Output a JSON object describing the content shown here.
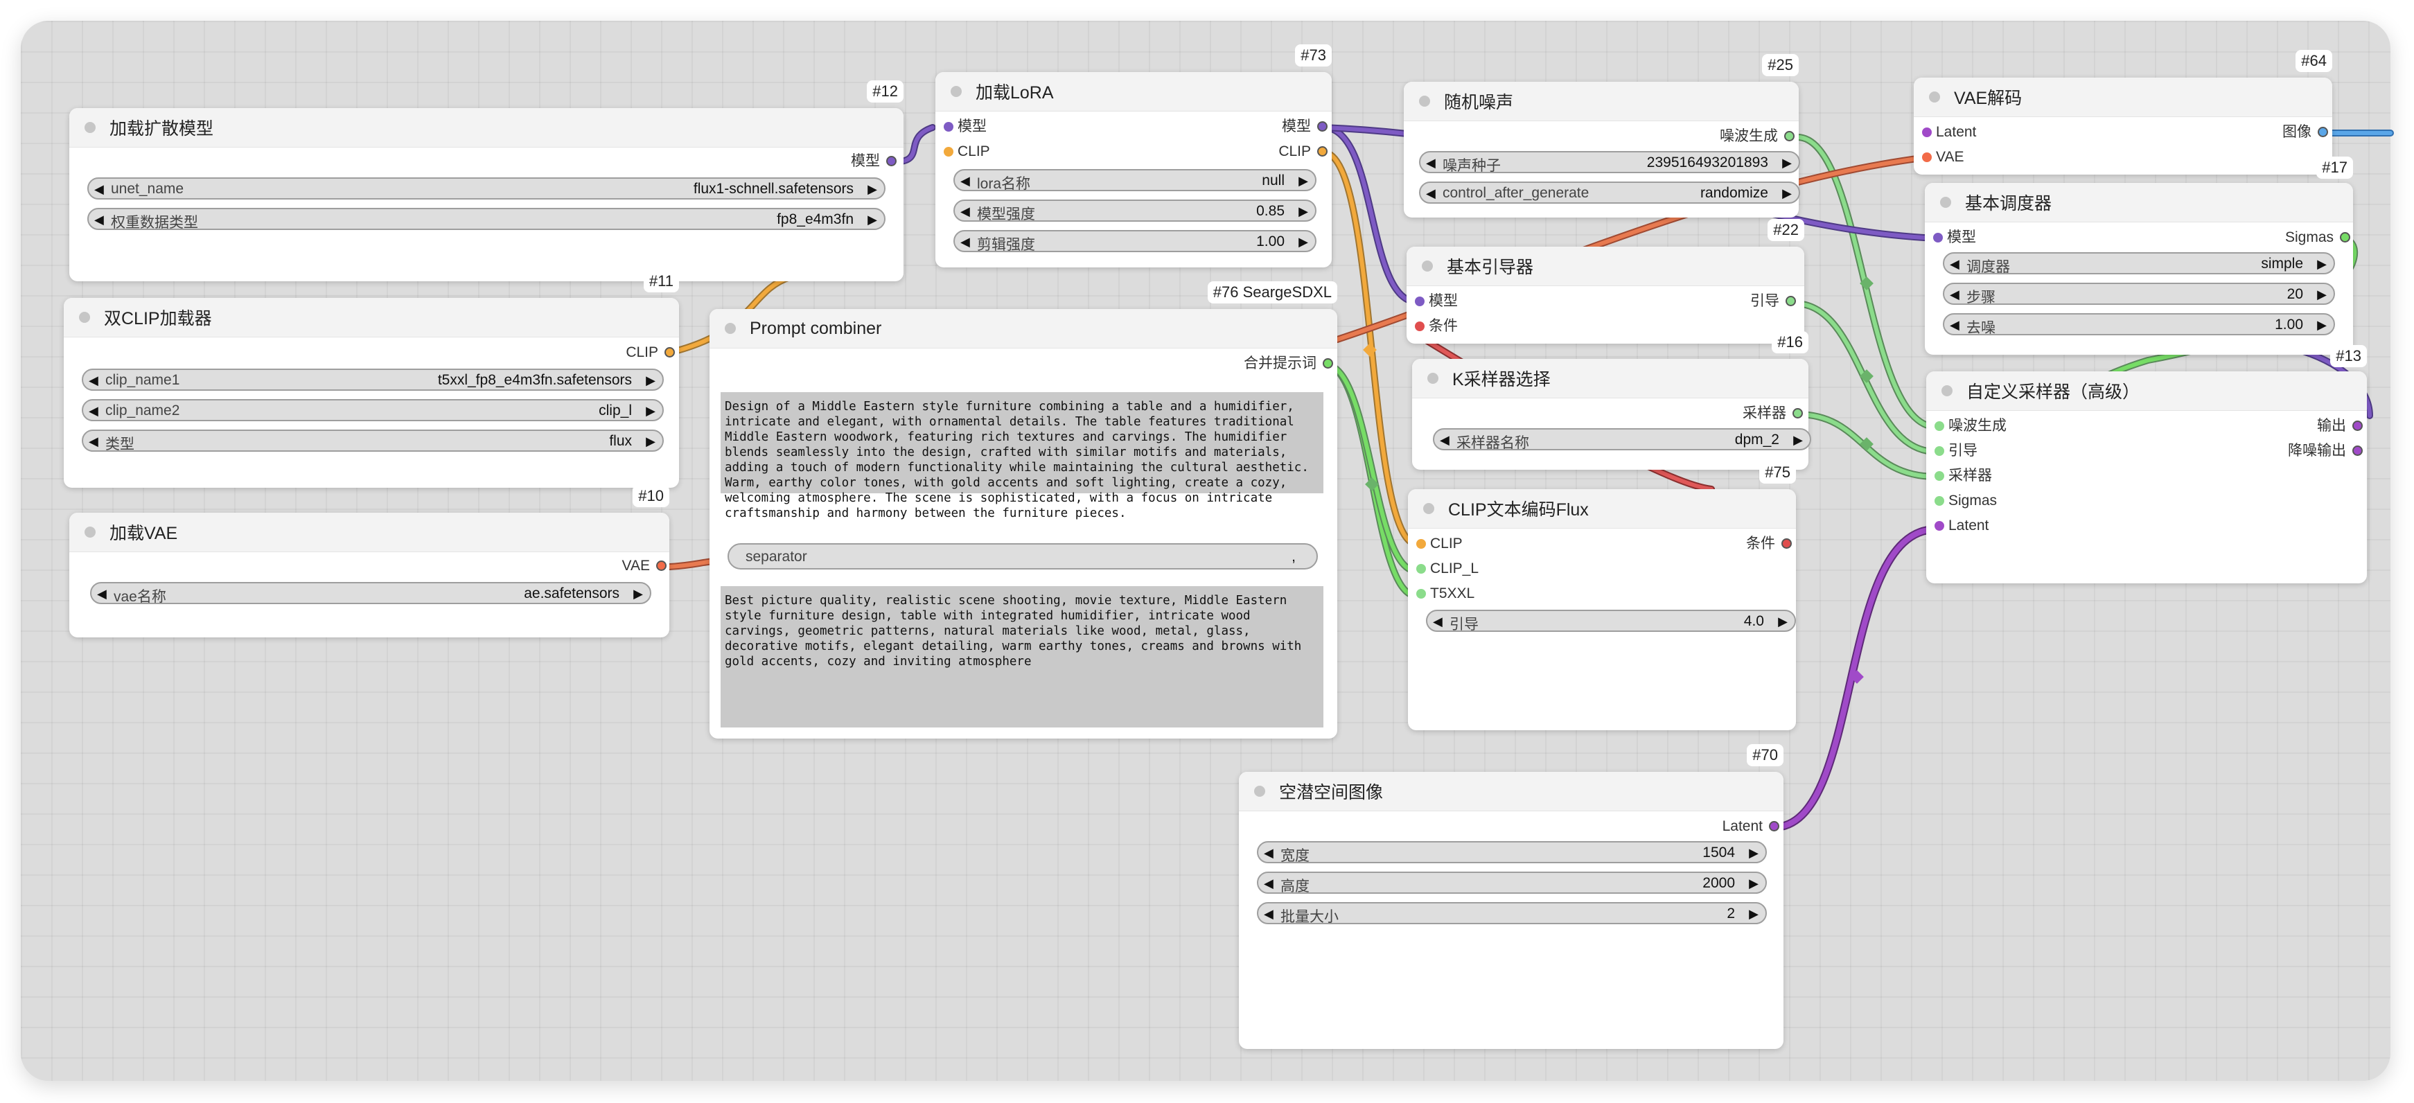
{
  "colors": {
    "model": "#7e5bc4",
    "clip": "#f2a93c",
    "vae": "#f26b48",
    "latent": "#a04ac8",
    "conditioning": "#e04e4e",
    "noise": "#8bdc8b",
    "sigmas": "#77dd66",
    "image": "#5aa6e8",
    "string": "#77dd66"
  },
  "nodes": {
    "n12": {
      "id": "#12",
      "title": "加载扩散模型",
      "outputs": [
        "模型"
      ],
      "widgets": [
        {
          "label": "unet_name",
          "value": "flux1-schnell.safetensors"
        },
        {
          "label": "权重数据类型",
          "value": "fp8_e4m3fn"
        }
      ]
    },
    "n11": {
      "id": "#11",
      "title": "双CLIP加载器",
      "outputs": [
        "CLIP"
      ],
      "widgets": [
        {
          "label": "clip_name1",
          "value": "t5xxl_fp8_e4m3fn.safetensors"
        },
        {
          "label": "clip_name2",
          "value": "clip_l"
        },
        {
          "label": "类型",
          "value": "flux"
        }
      ]
    },
    "n10": {
      "id": "#10",
      "title": "加载VAE",
      "outputs": [
        "VAE"
      ],
      "widgets": [
        {
          "label": "vae名称",
          "value": "ae.safetensors"
        }
      ]
    },
    "n73": {
      "id": "#73",
      "title": "加载LoRA",
      "inputs": [
        "模型",
        "CLIP"
      ],
      "outputs": [
        "模型",
        "CLIP"
      ],
      "widgets": [
        {
          "label": "lora名称",
          "value": "null"
        },
        {
          "label": "模型强度",
          "value": "0.85"
        },
        {
          "label": "剪辑强度",
          "value": "1.00"
        }
      ]
    },
    "n76": {
      "id": "#76 SeargeSDXL",
      "title": "Prompt combiner",
      "outputs": [
        "合并提示词"
      ],
      "text1": "Design of a Middle Eastern style furniture combining a table and a humidifier, intricate and elegant, with ornamental details. The table features traditional Middle Eastern woodwork, featuring rich textures and carvings. The humidifier blends seamlessly into the design, crafted with similar motifs and materials, adding a touch of modern functionality while maintaining the cultural aesthetic. Warm, earthy color tones, with gold accents and soft lighting, create a cozy, welcoming atmosphere. The scene is sophisticated, with a focus on intricate craftsmanship and harmony between the furniture pieces.",
      "separator_label": "separator",
      "separator_value": ",",
      "text2": "Best picture quality, realistic scene shooting, movie texture, Middle Eastern style furniture design, table with integrated humidifier, intricate wood carvings, geometric patterns, natural materials like wood, metal, glass, decorative motifs, elegant detailing, warm earthy tones, creams and browns with gold accents, cozy and inviting atmosphere"
    },
    "n25": {
      "id": "#25",
      "title": "随机噪声",
      "outputs": [
        "噪波生成"
      ],
      "widgets": [
        {
          "label": "噪声种子",
          "value": "239516493201893"
        },
        {
          "label": "control_after_generate",
          "value": "randomize"
        }
      ]
    },
    "n22": {
      "id": "#22",
      "title": "基本引导器",
      "inputs": [
        "模型",
        "条件"
      ],
      "outputs": [
        "引导"
      ]
    },
    "n16": {
      "id": "#16",
      "title": "K采样器选择",
      "outputs": [
        "采样器"
      ],
      "widgets": [
        {
          "label": "采样器名称",
          "value": "dpm_2"
        }
      ]
    },
    "n75": {
      "id": "#75",
      "title": "CLIP文本编码Flux",
      "inputs": [
        "CLIP",
        "CLIP_L",
        "T5XXL"
      ],
      "outputs": [
        "条件"
      ],
      "widgets": [
        {
          "label": "引导",
          "value": "4.0"
        }
      ]
    },
    "n70": {
      "id": "#70",
      "title": "空潜空间图像",
      "outputs": [
        "Latent"
      ],
      "widgets": [
        {
          "label": "宽度",
          "value": "1504"
        },
        {
          "label": "高度",
          "value": "2000"
        },
        {
          "label": "批量大小",
          "value": "2"
        }
      ]
    },
    "n64": {
      "id": "#64",
      "title": "VAE解码",
      "inputs": [
        "Latent",
        "VAE"
      ],
      "outputs": [
        "图像"
      ]
    },
    "n17": {
      "id": "#17",
      "title": "基本调度器",
      "inputs": [
        "模型"
      ],
      "outputs": [
        "Sigmas"
      ],
      "widgets": [
        {
          "label": "调度器",
          "value": "simple"
        },
        {
          "label": "步骤",
          "value": "20"
        },
        {
          "label": "去噪",
          "value": "1.00"
        }
      ]
    },
    "n13": {
      "id": "#13",
      "title": "自定义采样器（高级）",
      "inputs": [
        "噪波生成",
        "引导",
        "采样器",
        "Sigmas",
        "Latent"
      ],
      "outputs": [
        "输出",
        "降噪输出"
      ]
    }
  }
}
